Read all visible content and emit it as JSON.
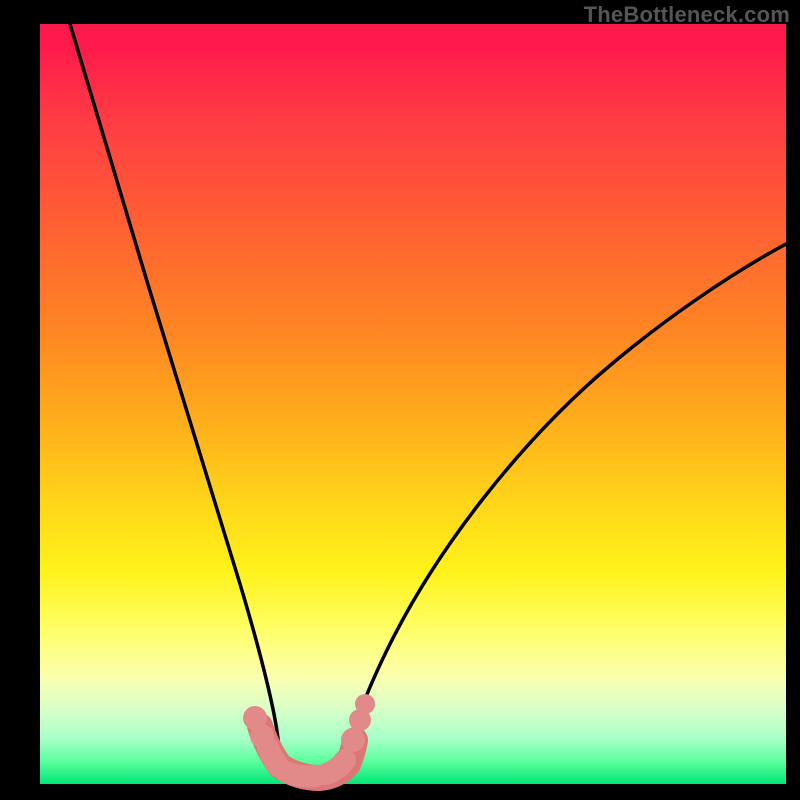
{
  "attribution": "TheBottleneck.com",
  "colors": {
    "background": "#000000",
    "curve": "#000000",
    "worm_body": "#dd7676",
    "worm_bead": "#e28a8a"
  },
  "chart_data": {
    "type": "line",
    "title": "",
    "xlabel": "",
    "ylabel": "",
    "xlim": [
      0,
      100
    ],
    "ylim": [
      0,
      100
    ],
    "grid": false,
    "gradient_meaning": "top = high bottleneck (red), bottom = no bottleneck (green)",
    "series": [
      {
        "name": "left-curve",
        "x": [
          4,
          8,
          12,
          16,
          20,
          24,
          27,
          29,
          30.8,
          32.2
        ],
        "y": [
          100,
          82,
          65,
          49,
          35,
          22,
          12,
          6,
          2,
          0
        ]
      },
      {
        "name": "right-curve",
        "x": [
          40.5,
          42,
          44.5,
          49,
          56,
          66,
          78,
          90,
          100
        ],
        "y": [
          0,
          3,
          8,
          16,
          27,
          40,
          52,
          62,
          69
        ]
      }
    ],
    "annotations": {
      "worm_spine": {
        "x": [
          29.5,
          30.6,
          32.2,
          34.8,
          37.6,
          39.8,
          41.2,
          42.2
        ],
        "y": [
          5.2,
          2.4,
          0.6,
          0.0,
          0.0,
          0.6,
          2.2,
          4.6
        ]
      },
      "worm_beads_left": {
        "x": [
          28.9,
          29.7
        ],
        "y": [
          8.0,
          5.8
        ]
      },
      "worm_beads_right": {
        "x": [
          42.0,
          42.9,
          43.6
        ],
        "y": [
          6.2,
          8.6,
          10.6
        ]
      }
    }
  }
}
